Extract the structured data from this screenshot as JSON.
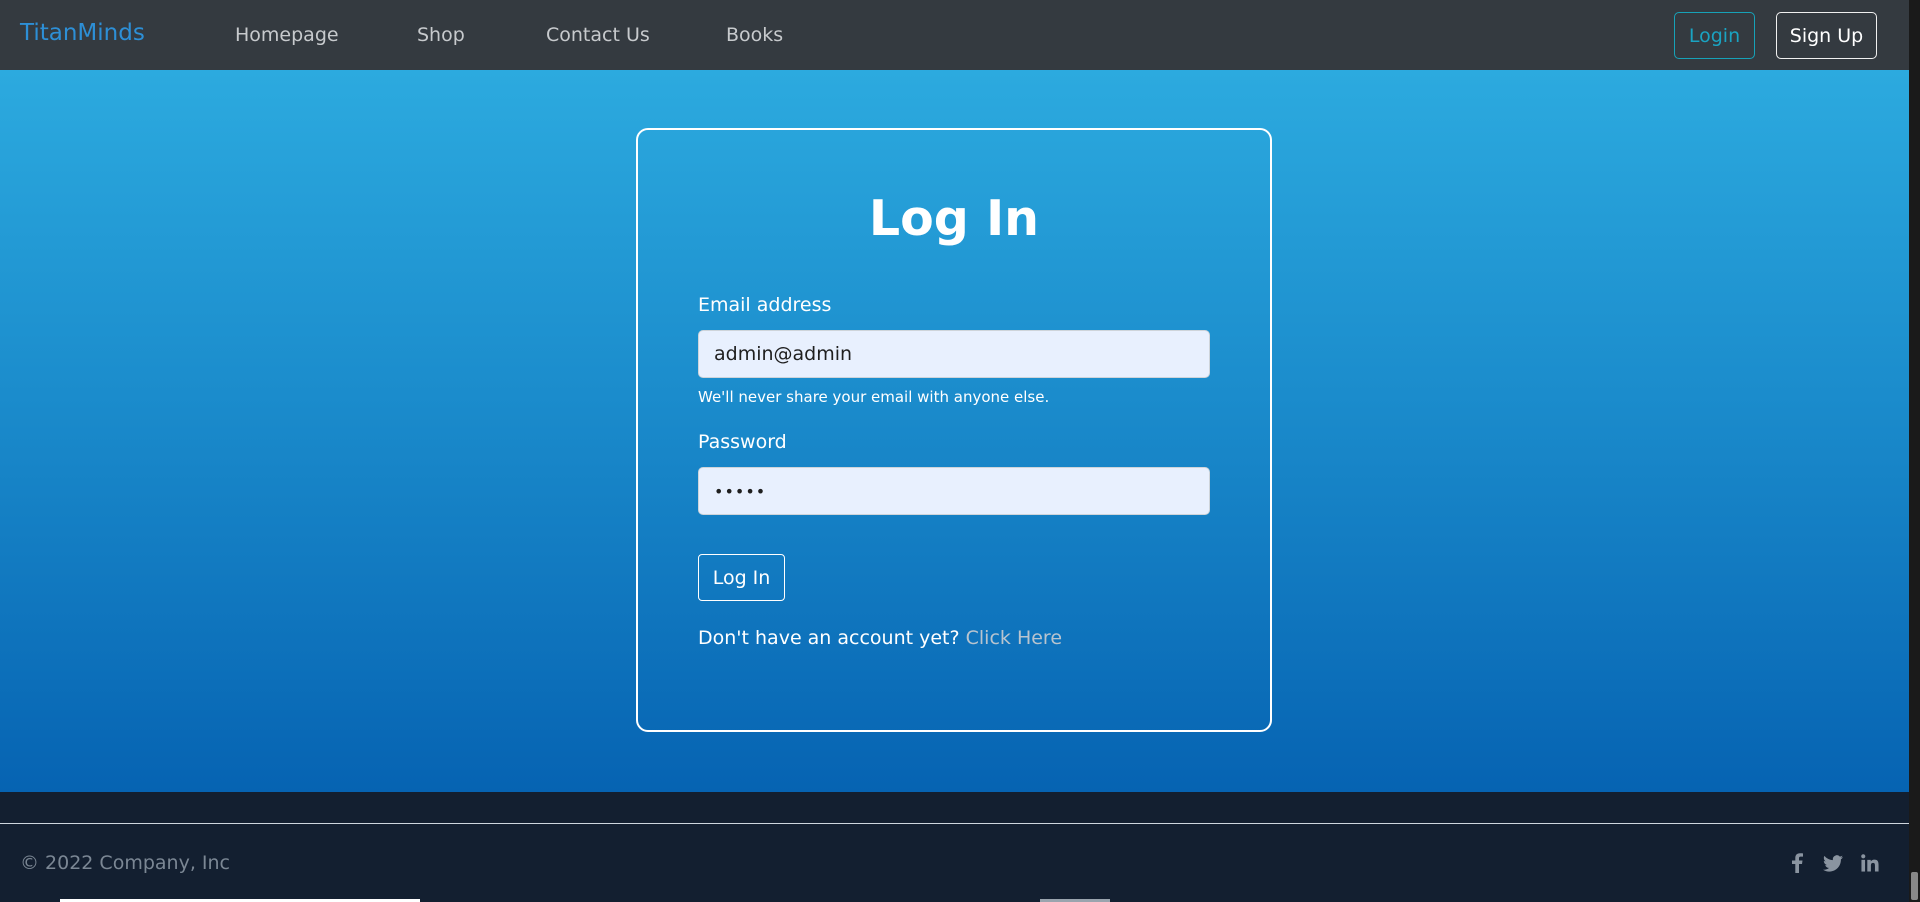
{
  "navbar": {
    "brand": "TitanMinds",
    "links": [
      "Homepage",
      "Shop",
      "Contact Us",
      "Books"
    ],
    "login_label": "Login",
    "signup_label": "Sign Up"
  },
  "login_card": {
    "title": "Log In",
    "email_label": "Email address",
    "email_value": "admin@admin",
    "email_help": "We'll never share your email with anyone else.",
    "password_label": "Password",
    "password_value": "•••••",
    "submit_label": "Log In",
    "signup_prompt": "Don't have an account yet?",
    "signup_link": "Click Here"
  },
  "footer": {
    "copyright": "© 2022 Company, Inc",
    "social_icons": [
      "facebook-icon",
      "twitter-icon",
      "linkedin-icon"
    ]
  },
  "colors": {
    "brand": "#2d8fd6",
    "navbar_bg": "#343a40",
    "login_outline": "#17a2b8",
    "hero_top": "#2caadf",
    "hero_bottom": "#0663b2",
    "footer_bg": "#131f30"
  }
}
